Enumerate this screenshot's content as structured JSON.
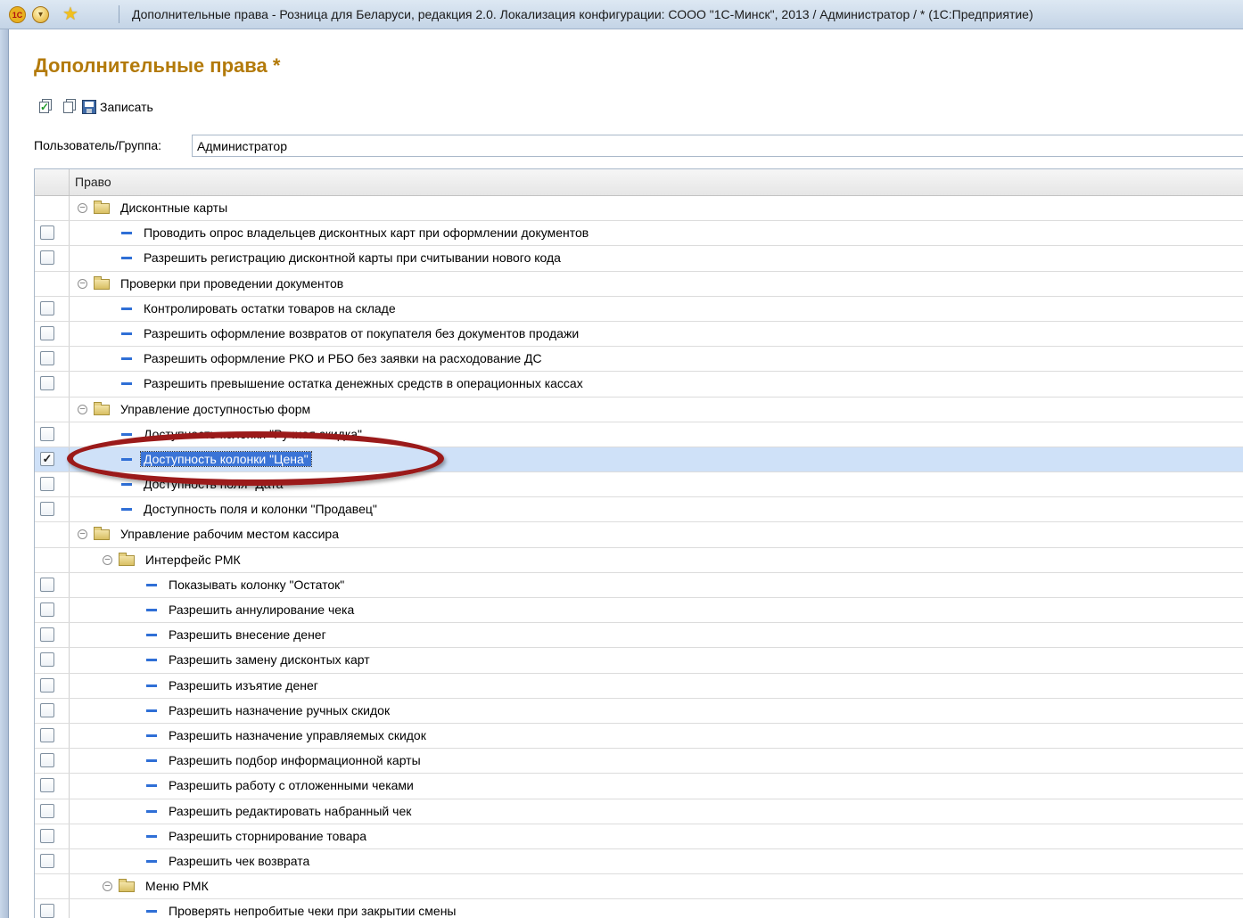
{
  "window": {
    "logo_label": "1С",
    "title": "Дополнительные права - Розница для Беларуси, редакция 2.0. Локализация конфигурации: СООО \"1С-Минск\", 2013 / Администратор / * (1С:Предприятие)"
  },
  "form": {
    "title": "Дополнительные права *"
  },
  "toolbar": {
    "save_label": "Записать"
  },
  "user_field": {
    "label": "Пользователь/Группа:",
    "value": "Администратор"
  },
  "grid": {
    "column_header": "Право",
    "rows": [
      {
        "type": "group",
        "level": 0,
        "label": "Дисконтные карты"
      },
      {
        "type": "item",
        "level": 1,
        "checked": false,
        "label": "Проводить опрос владельцев дисконтных карт при оформлении документов"
      },
      {
        "type": "item",
        "level": 1,
        "checked": false,
        "label": "Разрешить регистрацию дисконтной карты при считывании нового кода"
      },
      {
        "type": "group",
        "level": 0,
        "label": "Проверки при проведении документов"
      },
      {
        "type": "item",
        "level": 1,
        "checked": false,
        "label": "Контролировать остатки товаров на складе"
      },
      {
        "type": "item",
        "level": 1,
        "checked": false,
        "label": "Разрешить оформление возвратов от покупателя без документов продажи"
      },
      {
        "type": "item",
        "level": 1,
        "checked": false,
        "label": "Разрешить оформление РКО и РБО без заявки на расходование ДС"
      },
      {
        "type": "item",
        "level": 1,
        "checked": false,
        "label": "Разрешить превышение остатка денежных средств в операционных кассах"
      },
      {
        "type": "group",
        "level": 0,
        "label": "Управление доступностью форм"
      },
      {
        "type": "item",
        "level": 1,
        "checked": false,
        "label": "Доступность колонки \"Ручная скидка\""
      },
      {
        "type": "item",
        "level": 1,
        "checked": true,
        "selected": true,
        "label": "Доступность колонки \"Цена\""
      },
      {
        "type": "item",
        "level": 1,
        "checked": false,
        "label": "Доступность поля \"Дата\""
      },
      {
        "type": "item",
        "level": 1,
        "checked": false,
        "label": "Доступность поля и колонки \"Продавец\""
      },
      {
        "type": "group",
        "level": 0,
        "label": "Управление рабочим местом кассира"
      },
      {
        "type": "group",
        "level": 1,
        "label": "Интерфейс РМК"
      },
      {
        "type": "item",
        "level": 2,
        "checked": false,
        "label": "Показывать колонку \"Остаток\""
      },
      {
        "type": "item",
        "level": 2,
        "checked": false,
        "label": "Разрешить аннулирование чека"
      },
      {
        "type": "item",
        "level": 2,
        "checked": false,
        "label": "Разрешить внесение денег"
      },
      {
        "type": "item",
        "level": 2,
        "checked": false,
        "label": "Разрешить замену дисконтых карт"
      },
      {
        "type": "item",
        "level": 2,
        "checked": false,
        "label": "Разрешить изъятие денег"
      },
      {
        "type": "item",
        "level": 2,
        "checked": false,
        "label": "Разрешить назначение ручных скидок"
      },
      {
        "type": "item",
        "level": 2,
        "checked": false,
        "label": "Разрешить назначение управляемых скидок"
      },
      {
        "type": "item",
        "level": 2,
        "checked": false,
        "label": "Разрешить подбор информационной карты"
      },
      {
        "type": "item",
        "level": 2,
        "checked": false,
        "label": "Разрешить работу с отложенными чеками"
      },
      {
        "type": "item",
        "level": 2,
        "checked": false,
        "label": "Разрешить редактировать набранный чек"
      },
      {
        "type": "item",
        "level": 2,
        "checked": false,
        "label": "Разрешить сторнирование товара"
      },
      {
        "type": "item",
        "level": 2,
        "checked": false,
        "label": "Разрешить чек возврата"
      },
      {
        "type": "group",
        "level": 1,
        "label": "Меню РМК"
      },
      {
        "type": "item",
        "level": 2,
        "checked": false,
        "label": "Проверять непробитые чеки при закрытии смены"
      }
    ]
  },
  "colors": {
    "title": "#b37a0a",
    "selection": "#cfe1f8",
    "annotation": "#9b1a1a"
  },
  "icons": {
    "group_toggle": "collapse-circle-icon",
    "folder": "folder-icon",
    "item": "blue-dash-icon"
  }
}
